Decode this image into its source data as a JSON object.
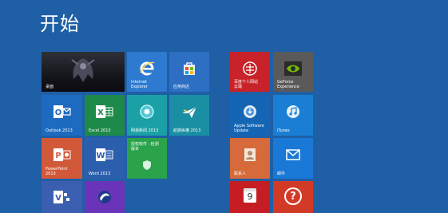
{
  "start": {
    "title": "开始"
  },
  "tiles": {
    "desktop": {
      "label": "桌面",
      "color": "#1a1a22"
    },
    "ie": {
      "label": "Internet\nExplorer",
      "color": "#2d7ad0"
    },
    "store": {
      "label": "应用商店",
      "color": "#2d6fc2"
    },
    "outlook": {
      "label": "Outlook 2013",
      "color": "#1c6bc0"
    },
    "excel": {
      "label": "Excel 2013",
      "color": "#1e8a4a"
    },
    "netease": {
      "label": "网易新闻 2013",
      "color": "#1ba0a6"
    },
    "flight": {
      "label": "航旅纵横 2013",
      "color": "#1a8fa3"
    },
    "powerpoint": {
      "label": "PowerPoint\n2013",
      "color": "#d2583a"
    },
    "word": {
      "label": "Word 2013",
      "color": "#2b5fad"
    },
    "green": {
      "label": "授权软件 · 检测\n版本",
      "color": "#2aa34a"
    },
    "visio": {
      "label": "",
      "color": "#3a5fb0"
    },
    "purple": {
      "label": "",
      "color": "#6a34b8"
    },
    "red_app": {
      "label": "百度个人网站\n云端",
      "color": "#c8222a"
    },
    "geforce": {
      "label": "GeForce\nExperience",
      "color": "#5a5a5a"
    },
    "apple_update": {
      "label": "Apple Software\nUpdate",
      "color": "#1565b5"
    },
    "itunes": {
      "label": "iTunes",
      "color": "#1a7fd4"
    },
    "contacts": {
      "label": "联系人",
      "color": "#d66a3a"
    },
    "mail": {
      "label": "邮件",
      "color": "#1a78d6"
    },
    "calendar": {
      "label": "9",
      "color": "#c41e24"
    },
    "help": {
      "label": "?",
      "color": "#d23a28"
    }
  }
}
